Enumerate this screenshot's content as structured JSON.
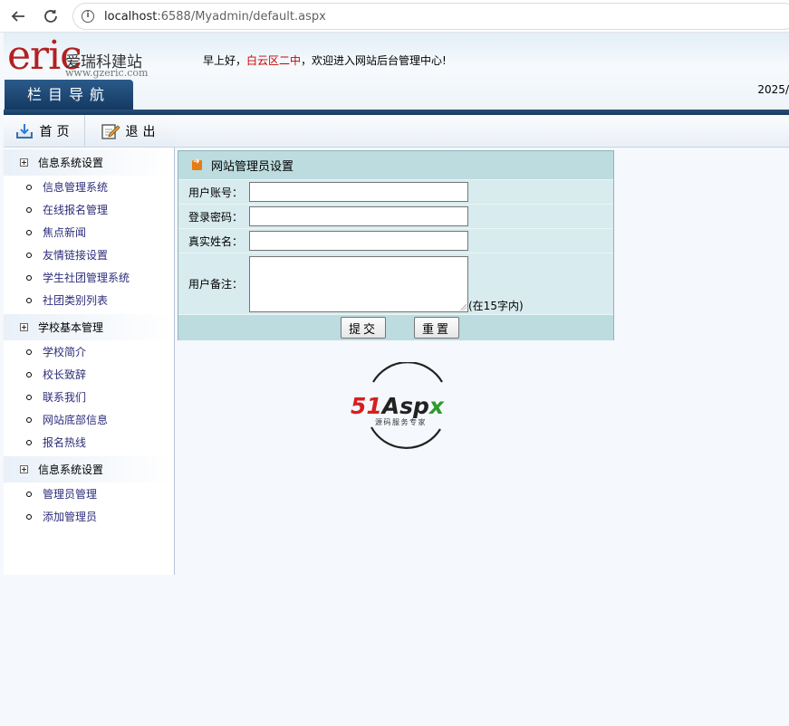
{
  "browser": {
    "url_host": "localhost",
    "url_rest": ":6588/Myadmin/default.aspx"
  },
  "header": {
    "logo_text": "eric",
    "logo_cn": "爱瑞科建站",
    "logo_domain": "www.gzeric.com",
    "greeting_prefix": "早上好，",
    "greeting_school": "白云区二中",
    "greeting_suffix": "，欢迎进入网站后台管理中心!",
    "nav_tab": "栏目导航",
    "date": "2025/"
  },
  "toolbar": {
    "home_label": "首页",
    "logout_label": "退出"
  },
  "sidebar": {
    "groups": [
      {
        "title": "信息系统设置",
        "items": [
          "信息管理系统",
          "在线报名管理",
          "焦点新闻",
          "友情链接设置",
          "学生社团管理系统",
          "社团类别列表"
        ]
      },
      {
        "title": "学校基本管理",
        "items": [
          "学校简介",
          "校长致辞",
          "联系我们",
          "网站底部信息",
          "报名热线"
        ]
      },
      {
        "title": "信息系统设置",
        "items": [
          "管理员管理",
          "添加管理员"
        ]
      }
    ]
  },
  "form": {
    "title": "网站管理员设置",
    "username_label": "用户账号：",
    "password_label": "登录密码：",
    "realname_label": "真实姓名：",
    "remark_label": "用户备注：",
    "remark_hint": "(在15字内)",
    "submit_label": "提交",
    "reset_label": "重置"
  },
  "badge": {
    "brand_red": "51",
    "brand_dark": "Asp",
    "brand_green": "x",
    "tagline": "源码服务专家"
  },
  "colors": {
    "accent_red": "#c00000",
    "nav_blue": "#143a62",
    "panel_teal": "#bcdcdf",
    "brand_green": "#2e9b2e"
  }
}
